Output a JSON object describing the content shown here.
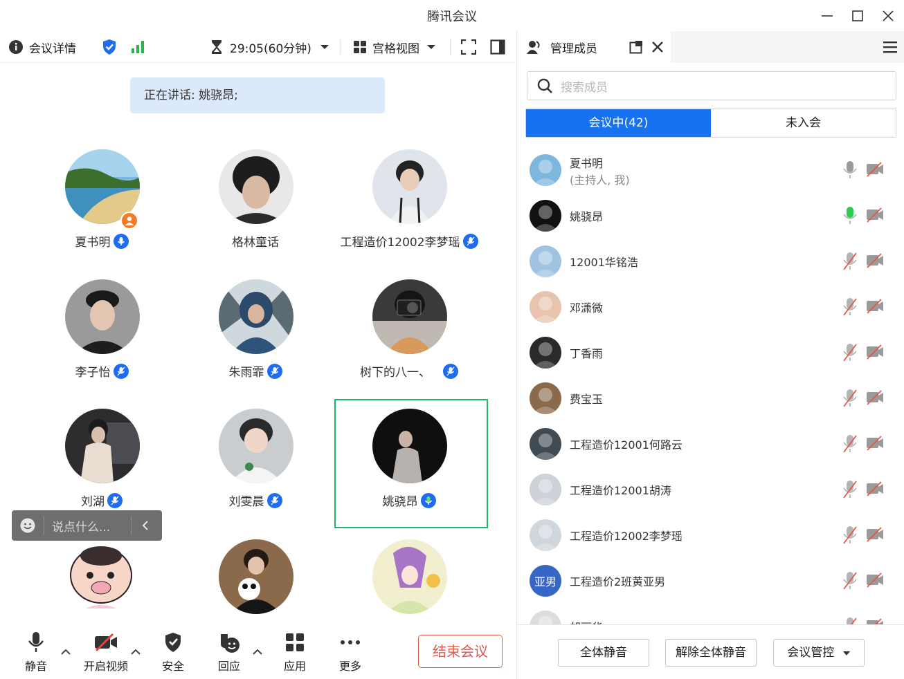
{
  "window": {
    "title": "腾讯会议"
  },
  "toolbar": {
    "details_label": "会议详情",
    "timer": "29:05(60分钟)",
    "view_label": "宫格视图"
  },
  "speaking": {
    "text": "正在讲话: 姚骁昂;"
  },
  "grid": {
    "tiles": [
      {
        "name": "夏书明"
      },
      {
        "name": "格林童话"
      },
      {
        "name": "工程造价12002李梦瑶"
      },
      {
        "name": "李子怡"
      },
      {
        "name": "朱雨霏"
      },
      {
        "name": "树下的八一、"
      },
      {
        "name": "刘湖"
      },
      {
        "name": "刘雯晨"
      },
      {
        "name": "姚骁昂"
      }
    ]
  },
  "chat": {
    "placeholder": "说点什么..."
  },
  "bottom": {
    "mute": "静音",
    "video": "开启视频",
    "security": "安全",
    "react": "回应",
    "apps": "应用",
    "more": "更多",
    "end": "结束会议"
  },
  "panel": {
    "tab_title": "管理成员",
    "search_placeholder": "搜索成员",
    "seg_in": "会议中(42)",
    "seg_out": "未入会",
    "members": [
      {
        "name": "夏书明",
        "sub": "(主持人, 我)",
        "mic": "on"
      },
      {
        "name": "姚骁昂",
        "mic": "speaking"
      },
      {
        "name": "12001华铭浩",
        "mic": "muted"
      },
      {
        "name": "邓潇微",
        "mic": "muted"
      },
      {
        "name": "丁香雨",
        "mic": "muted"
      },
      {
        "name": "费宝玉",
        "mic": "muted"
      },
      {
        "name": "工程造价12001何路云",
        "mic": "muted"
      },
      {
        "name": "工程造价12001胡涛",
        "mic": "muted"
      },
      {
        "name": "工程造价12002李梦瑶",
        "mic": "muted"
      },
      {
        "name": "工程造价2班黄亚男",
        "avatar_text": "亚男",
        "mic": "muted"
      },
      {
        "name": "胡丽华",
        "mic": "muted"
      }
    ],
    "mute_all": "全体静音",
    "unmute_all": "解除全体静音",
    "control": "会议管控"
  }
}
